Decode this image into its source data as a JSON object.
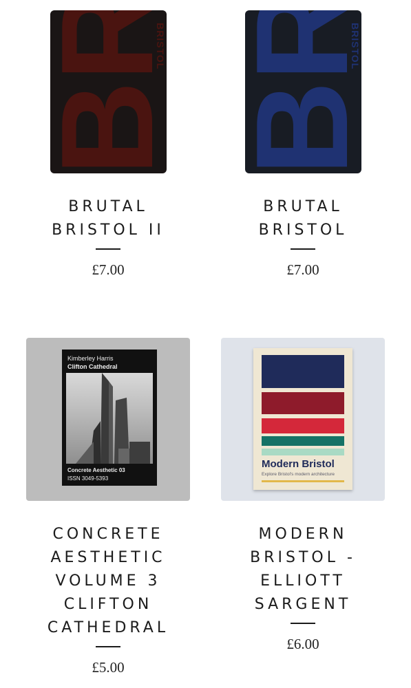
{
  "products": [
    {
      "title_lines": [
        "BRUTAL",
        "BRISTOL II"
      ],
      "price": "£7.00",
      "cover": {
        "big_text": "BRUTAL",
        "small_text": "BRISTOL",
        "base_color": "#1a1515",
        "accent_color": "#4a1410"
      }
    },
    {
      "title_lines": [
        "BRUTAL",
        "BRISTOL"
      ],
      "price": "£7.00",
      "cover": {
        "big_text": "BRUTAL",
        "small_text": "BRISTOL",
        "base_color": "#181c24",
        "accent_color": "#1f3272"
      }
    },
    {
      "title_lines": [
        "CONCRETE",
        "AESTHETIC",
        "VOLUME 3",
        "CLIFTON",
        "CATHEDRAL"
      ],
      "price": "£5.00",
      "cover": {
        "author": "Kimberley Harris",
        "subject": "Clifton Cathedral",
        "series": "Concrete Aesthetic 03",
        "issn": "ISSN 3049-5393"
      }
    },
    {
      "title_lines": [
        "MODERN",
        "BRISTOL -",
        "ELLIOTT",
        "SARGENT"
      ],
      "price": "£6.00",
      "cover": {
        "title": "Modern Bristol",
        "subtitle": "Explore Bristol's modern architecture",
        "stripe_colors": [
          "#1f2b5a",
          "#8e1b2b",
          "#d4283a",
          "#157266",
          "#a9dac4"
        ]
      }
    }
  ]
}
